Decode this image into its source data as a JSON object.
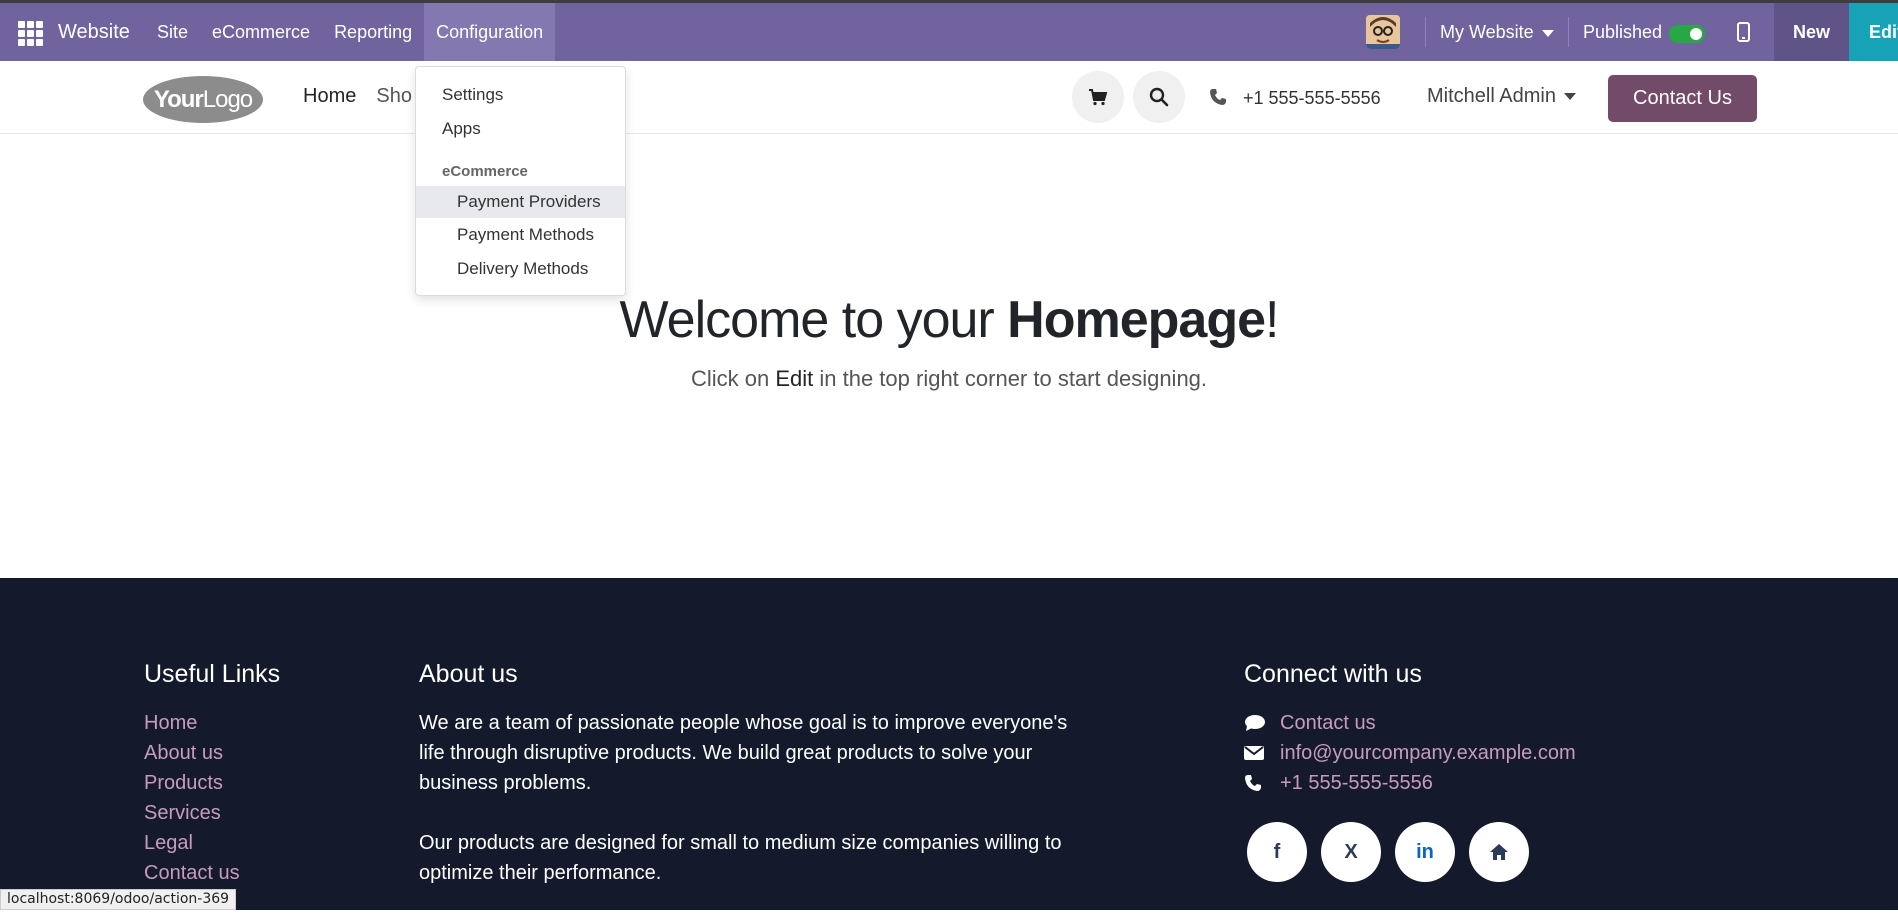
{
  "topbar": {
    "brand": "Website",
    "menu": [
      "Site",
      "eCommerce",
      "Reporting",
      "Configuration"
    ],
    "my_website": "My Website",
    "published": "Published",
    "new_label": "New",
    "edit_label": "Edit"
  },
  "dropdown": {
    "items": [
      "Settings",
      "Apps"
    ],
    "section_header": "eCommerce",
    "sub_items": [
      "Payment Providers",
      "Payment Methods",
      "Delivery Methods"
    ]
  },
  "header": {
    "logo_part1": "Your",
    "logo_part2": "Logo",
    "nav": [
      "Home",
      "Sho"
    ],
    "phone": "+1 555-555-5556",
    "user": "Mitchell Admin",
    "contact_button": "Contact Us"
  },
  "hero": {
    "title_prefix": "Welcome to your ",
    "title_bold": "Homepage",
    "title_suffix": "!",
    "sub_prefix": "Click on ",
    "sub_edit": "Edit",
    "sub_suffix": " in the top right corner to start designing."
  },
  "footer": {
    "useful_links_title": "Useful Links",
    "links": [
      "Home",
      "About us",
      "Products",
      "Services",
      "Legal",
      "Contact us"
    ],
    "about_title": "About us",
    "about_p1": "We are a team of passionate people whose goal is to improve everyone's life through disruptive products. We build great products to solve your business problems.",
    "about_p2": "Our products are designed for small to medium size companies willing to optimize their performance.",
    "connect_title": "Connect with us",
    "contact_us": "Contact us",
    "email": "info@yourcompany.example.com",
    "phone": "+1 555-555-5556",
    "socials": [
      "f",
      "X",
      "in",
      "home"
    ]
  },
  "statusbar": {
    "url": "localhost:8069/odoo/action-369"
  },
  "colors": {
    "topbar": "#71639e",
    "accent": "#714b67",
    "footer": "#141a2c",
    "link": "#c79bbf"
  }
}
